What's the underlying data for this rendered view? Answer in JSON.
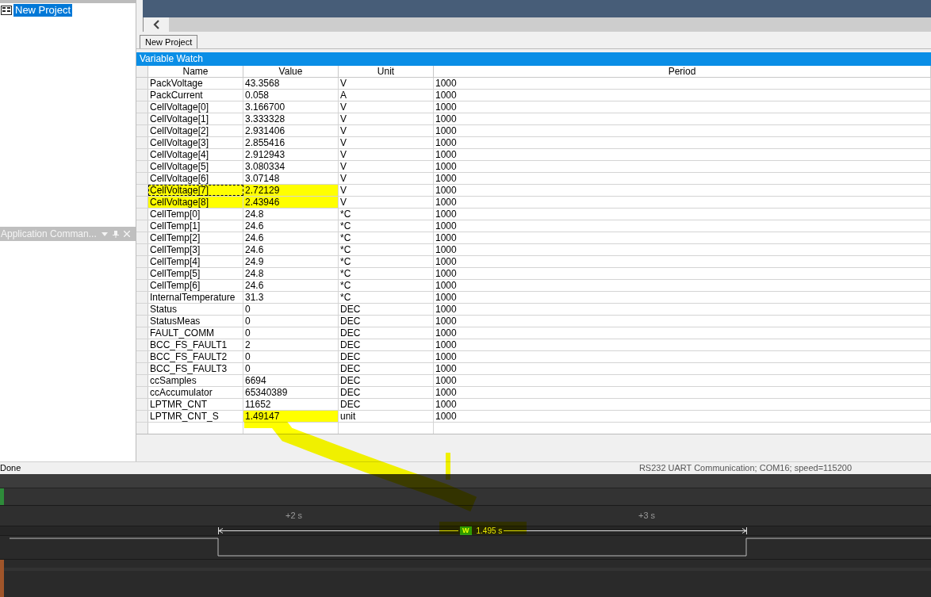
{
  "project_tree": {
    "items": [
      {
        "label": "New Project",
        "selected": true
      }
    ]
  },
  "side_panel": {
    "title": "Application Comman..."
  },
  "document_tabs": [
    {
      "label": "New Project",
      "selected": true
    }
  ],
  "watch": {
    "title": "Variable Watch",
    "columns": [
      "Name",
      "Value",
      "Unit",
      "Period"
    ],
    "rows": [
      {
        "name": "PackVoltage",
        "value": "43.3568",
        "unit": "V",
        "period": "1000",
        "name_highlighted": false,
        "value_highlighted": false,
        "focused": false
      },
      {
        "name": "PackCurrent",
        "value": "0.058",
        "unit": "A",
        "period": "1000",
        "name_highlighted": false,
        "value_highlighted": false,
        "focused": false
      },
      {
        "name": "CellVoltage[0]",
        "value": "3.166700",
        "unit": "V",
        "period": "1000",
        "name_highlighted": false,
        "value_highlighted": false,
        "focused": false
      },
      {
        "name": "CellVoltage[1]",
        "value": "3.333328",
        "unit": "V",
        "period": "1000",
        "name_highlighted": false,
        "value_highlighted": false,
        "focused": false
      },
      {
        "name": "CellVoltage[2]",
        "value": "2.931406",
        "unit": "V",
        "period": "1000",
        "name_highlighted": false,
        "value_highlighted": false,
        "focused": false
      },
      {
        "name": "CellVoltage[3]",
        "value": "2.855416",
        "unit": "V",
        "period": "1000",
        "name_highlighted": false,
        "value_highlighted": false,
        "focused": false
      },
      {
        "name": "CellVoltage[4]",
        "value": "2.912943",
        "unit": "V",
        "period": "1000",
        "name_highlighted": false,
        "value_highlighted": false,
        "focused": false
      },
      {
        "name": "CellVoltage[5]",
        "value": "3.080334",
        "unit": "V",
        "period": "1000",
        "name_highlighted": false,
        "value_highlighted": false,
        "focused": false
      },
      {
        "name": "CellVoltage[6]",
        "value": "3.07148",
        "unit": "V",
        "period": "1000",
        "name_highlighted": false,
        "value_highlighted": false,
        "focused": false
      },
      {
        "name": "CellVoltage[7]",
        "value": "2.72129",
        "unit": "V",
        "period": "1000",
        "name_highlighted": true,
        "value_highlighted": true,
        "focused": true
      },
      {
        "name": "CellVoltage[8]",
        "value": "2.43946",
        "unit": "V",
        "period": "1000",
        "name_highlighted": true,
        "value_highlighted": true,
        "focused": false
      },
      {
        "name": "CellTemp[0]",
        "value": "24.8",
        "unit": "*C",
        "period": "1000",
        "name_highlighted": false,
        "value_highlighted": false,
        "focused": false
      },
      {
        "name": "CellTemp[1]",
        "value": "24.6",
        "unit": "*C",
        "period": "1000",
        "name_highlighted": false,
        "value_highlighted": false,
        "focused": false
      },
      {
        "name": "CellTemp[2]",
        "value": "24.6",
        "unit": "*C",
        "period": "1000",
        "name_highlighted": false,
        "value_highlighted": false,
        "focused": false
      },
      {
        "name": "CellTemp[3]",
        "value": "24.6",
        "unit": "*C",
        "period": "1000",
        "name_highlighted": false,
        "value_highlighted": false,
        "focused": false
      },
      {
        "name": "CellTemp[4]",
        "value": "24.9",
        "unit": "*C",
        "period": "1000",
        "name_highlighted": false,
        "value_highlighted": false,
        "focused": false
      },
      {
        "name": "CellTemp[5]",
        "value": "24.8",
        "unit": "*C",
        "period": "1000",
        "name_highlighted": false,
        "value_highlighted": false,
        "focused": false
      },
      {
        "name": "CellTemp[6]",
        "value": "24.6",
        "unit": "*C",
        "period": "1000",
        "name_highlighted": false,
        "value_highlighted": false,
        "focused": false
      },
      {
        "name": "InternalTemperature",
        "value": "31.3",
        "unit": "*C",
        "period": "1000",
        "name_highlighted": false,
        "value_highlighted": false,
        "focused": false
      },
      {
        "name": "Status",
        "value": "0",
        "unit": "DEC",
        "period": "1000",
        "name_highlighted": false,
        "value_highlighted": false,
        "focused": false
      },
      {
        "name": "StatusMeas",
        "value": "0",
        "unit": "DEC",
        "period": "1000",
        "name_highlighted": false,
        "value_highlighted": false,
        "focused": false
      },
      {
        "name": "FAULT_COMM",
        "value": "0",
        "unit": "DEC",
        "period": "1000",
        "name_highlighted": false,
        "value_highlighted": false,
        "focused": false
      },
      {
        "name": "BCC_FS_FAULT1",
        "value": "2",
        "unit": "DEC",
        "period": "1000",
        "name_highlighted": false,
        "value_highlighted": false,
        "focused": false
      },
      {
        "name": "BCC_FS_FAULT2",
        "value": "0",
        "unit": "DEC",
        "period": "1000",
        "name_highlighted": false,
        "value_highlighted": false,
        "focused": false
      },
      {
        "name": "BCC_FS_FAULT3",
        "value": "0",
        "unit": "DEC",
        "period": "1000",
        "name_highlighted": false,
        "value_highlighted": false,
        "focused": false
      },
      {
        "name": "ccSamples",
        "value": "6694",
        "unit": "DEC",
        "period": "1000",
        "name_highlighted": false,
        "value_highlighted": false,
        "focused": false
      },
      {
        "name": "ccAccumulator",
        "value": "65340389",
        "unit": "DEC",
        "period": "1000",
        "name_highlighted": false,
        "value_highlighted": false,
        "focused": false
      },
      {
        "name": "LPTMR_CNT",
        "value": "11652",
        "unit": "DEC",
        "period": "1000",
        "name_highlighted": false,
        "value_highlighted": false,
        "focused": false
      },
      {
        "name": "LPTMR_CNT_S",
        "value": "1.49147",
        "unit": "unit",
        "period": "1000",
        "name_highlighted": false,
        "value_highlighted": true,
        "focused": false
      }
    ]
  },
  "status_bar": {
    "left": "Done",
    "right": "RS232 UART Communication; COM16; speed=115200"
  },
  "logic": {
    "ticks": [
      "+2 s",
      "+3 s"
    ],
    "measurement": {
      "badge": "W",
      "value": "1.495 s"
    }
  }
}
